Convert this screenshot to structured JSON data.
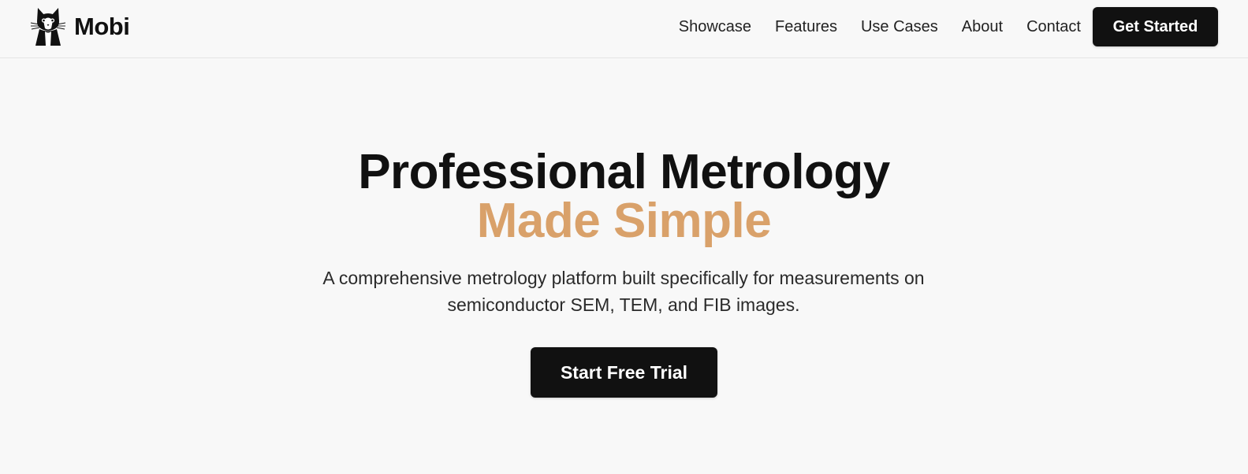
{
  "brand": {
    "name": "Mobi",
    "logo_icon": "cat-logo-icon"
  },
  "nav": {
    "items": [
      {
        "label": "Showcase"
      },
      {
        "label": "Features"
      },
      {
        "label": "Use Cases"
      },
      {
        "label": "About"
      },
      {
        "label": "Contact"
      }
    ],
    "cta_label": "Get Started"
  },
  "hero": {
    "title": "Professional Metrology",
    "title_accent": "Made Simple",
    "subtitle_line1": "A comprehensive metrology platform built specifically for measurements on",
    "subtitle_line2": "semiconductor SEM, TEM, and FIB images.",
    "cta_label": "Start Free Trial"
  },
  "colors": {
    "background": "#f8f8f8",
    "primary": "#111111",
    "accent": "#d9a16a"
  }
}
